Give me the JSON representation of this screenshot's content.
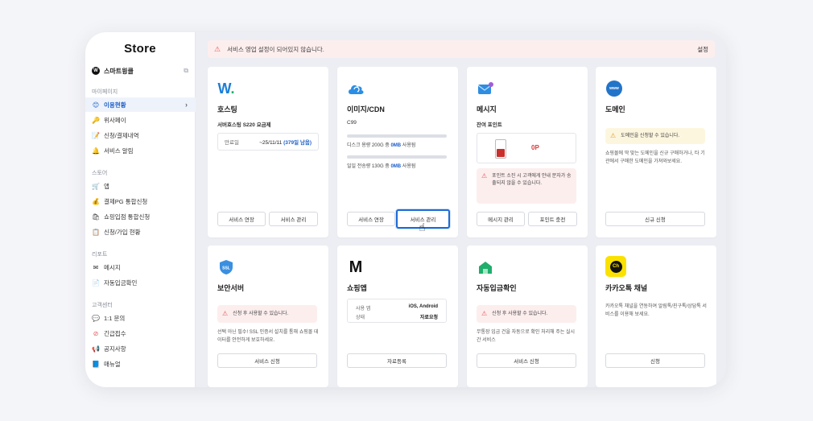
{
  "sidebar": {
    "title": "Store",
    "shop_name": "스마트윙클",
    "sections": [
      {
        "title": "마이페이지",
        "items": [
          "이용현황",
          "위사페이",
          "신청/결제내역",
          "서비스 알림"
        ]
      },
      {
        "title": "스토어",
        "items": [
          "앱",
          "결제PG 통합신청",
          "쇼핑입점 통합신청",
          "신청/가입 현황"
        ]
      },
      {
        "title": "리포트",
        "items": [
          "메시지",
          "자동입금확인"
        ]
      },
      {
        "title": "고객센터",
        "items": [
          "1:1 문의",
          "긴급접수",
          "공지사항",
          "매뉴얼"
        ]
      }
    ]
  },
  "banner": {
    "text": "서비스 영업 설정이 되어있지 않습니다.",
    "settings": "설정"
  },
  "cards": {
    "hosting": {
      "title": "호스팅",
      "sub": "서버호스팅 S220 요금제",
      "expiry_label": "만료일",
      "expiry_value": "~25/11/11",
      "days_left": "(379일 남음)",
      "btn1": "서비스 연장",
      "btn2": "서비스 관리"
    },
    "cdn": {
      "title": "이미지/CDN",
      "sub": "C99",
      "disk_text1": "디스크 용량 200G 중 ",
      "disk_used": "0MB",
      "disk_text2": " 사용됨",
      "traffic_text1": "일일 전송량 130G 중 ",
      "traffic_used": "0MB",
      "traffic_text2": " 사용됨",
      "btn1": "서비스 연장",
      "btn2": "서비스 관리"
    },
    "message": {
      "title": "메시지",
      "sub": "잔여 포인트",
      "points": "0P",
      "notice": "포인트 소진 시 고객에게 안내 문자가 송출되지 않을 수 있습니다.",
      "btn1": "메시지 관리",
      "btn2": "포인트 충전"
    },
    "domain": {
      "title": "도메인",
      "notice": "도메인을 신청할 수 있습니다.",
      "desc": "쇼핑몰에 딱 맞는 도메인을 신규 구매하거나, 타 기관에서 구매한 도메인을 가져와보세요.",
      "btn": "신규 신청"
    },
    "ssl": {
      "title": "보안서버",
      "notice": "신청 후 사용할 수 있습니다.",
      "desc": "선택 아닌 필수! SSL 인증서 설치를 통해 쇼핑몰 데이터를 안전하게 보호하세요.",
      "btn": "서비스 신청"
    },
    "shopapp": {
      "title": "쇼핑앱",
      "row1_label": "사용 앱",
      "row1_value": "iOS, Android",
      "row2_label": "상태",
      "row2_value": "자료요청",
      "btn": "자료등록"
    },
    "deposit": {
      "title": "자동입금확인",
      "notice": "신청 후 사용할 수 있습니다.",
      "desc": "무통장 입금 건을 자동으로 확인 처리해 주는 실시간 서비스",
      "btn": "서비스 신청"
    },
    "kakao": {
      "title": "카카오톡 채널",
      "desc": "카카오톡 채널을 연동하여 알림톡/친구톡/상담톡 서비스를 이용해 보세요.",
      "btn": "신청",
      "logo_text": "Ch"
    }
  },
  "colors": {
    "accent": "#1d5fc9",
    "warn": "#e25c5c",
    "kakao": "#fae100"
  }
}
